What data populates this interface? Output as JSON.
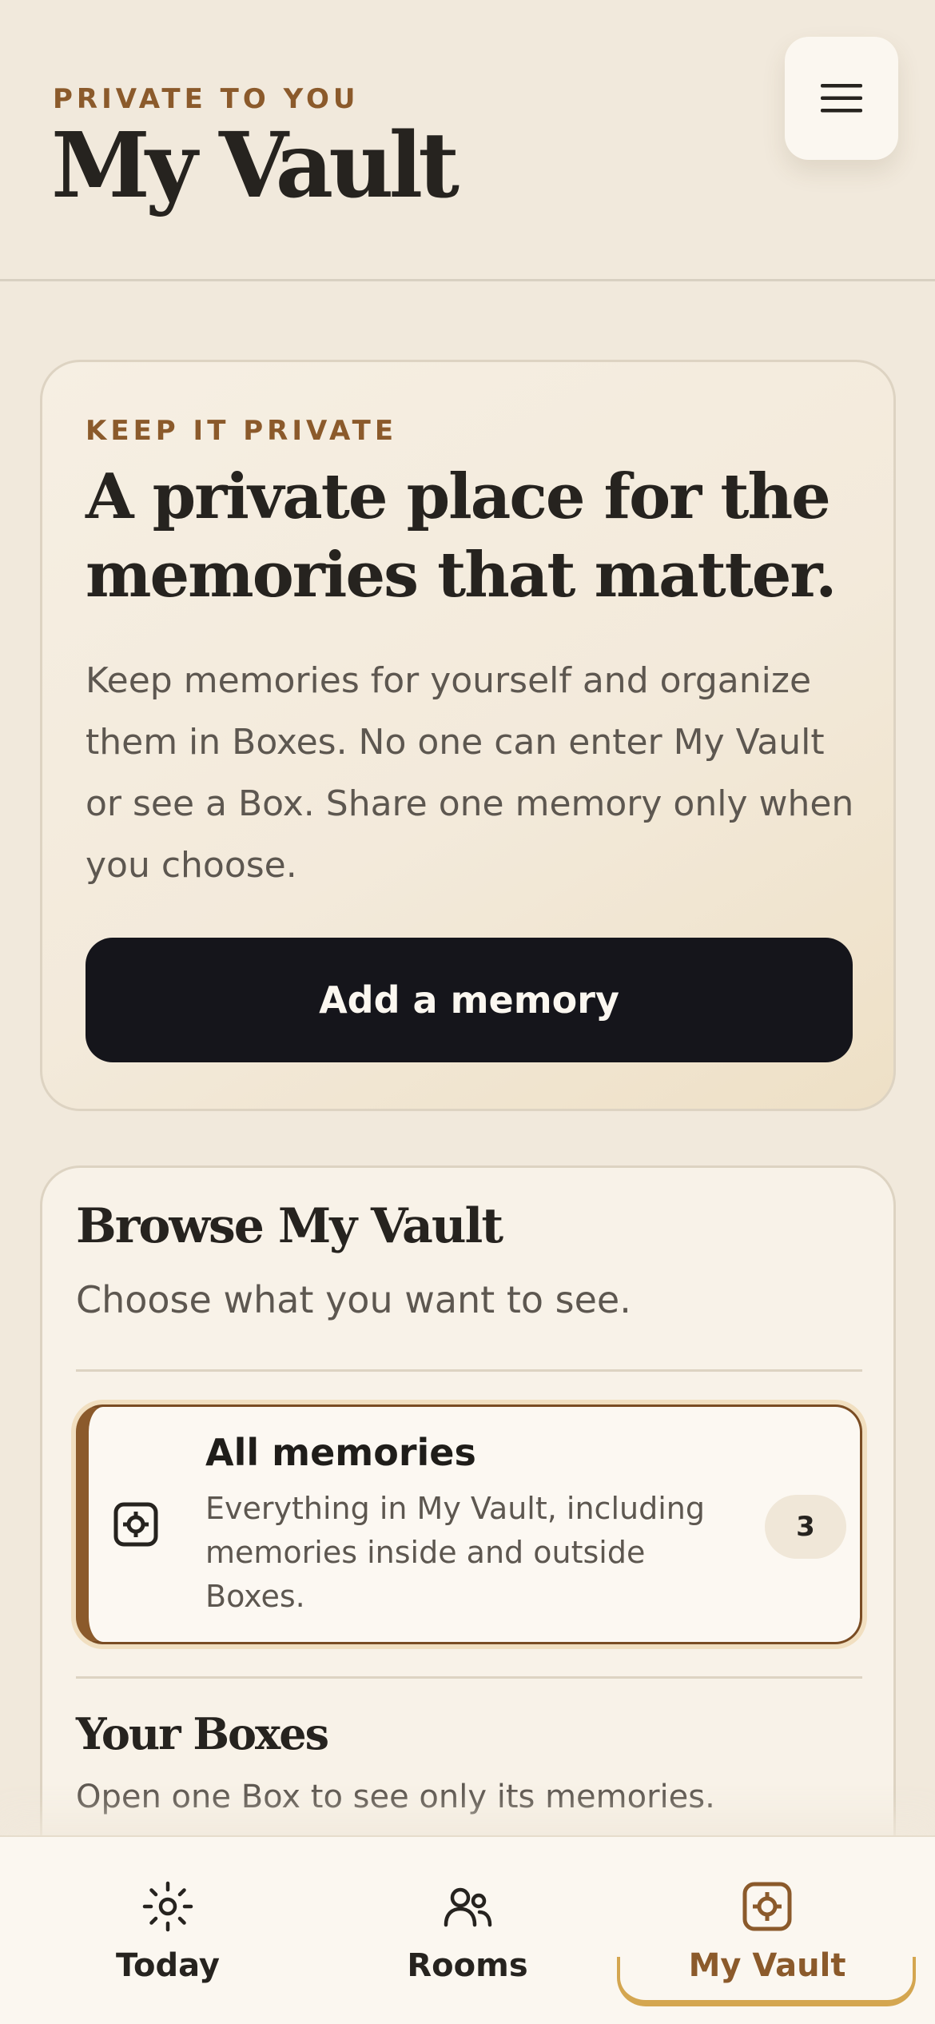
{
  "header": {
    "eyebrow": "PRIVATE TO YOU",
    "title": "My Vault",
    "menu_icon": "hamburger-menu-icon"
  },
  "intro": {
    "eyebrow": "KEEP IT PRIVATE",
    "title": "A private place for the memories that matter.",
    "body": "Keep memories for yourself and organize them in Boxes. No one can enter My Vault or see a Box. Share one memory only when you choose.",
    "button_label": "Add a memory"
  },
  "browse": {
    "title": "Browse My Vault",
    "subtitle": "Choose what you want to see.",
    "filter": {
      "icon": "vault-icon",
      "title": "All memories",
      "description": "Everything in My Vault, including memories inside and outside Boxes.",
      "count": "3",
      "selected": true
    },
    "boxes_title": "Your Boxes",
    "boxes_subtitle": "Open one Box to see only its memories."
  },
  "tabbar": {
    "tabs": [
      {
        "label": "Today",
        "icon": "sun-icon",
        "active": false
      },
      {
        "label": "Rooms",
        "icon": "people-icon",
        "active": false
      },
      {
        "label": "My Vault",
        "icon": "vault-icon",
        "active": true
      }
    ]
  },
  "colors": {
    "background": "#f1e9dc",
    "accent": "#8b5a2b",
    "primary_button": "#15151b",
    "active_tab_underline": "#d4a650"
  }
}
